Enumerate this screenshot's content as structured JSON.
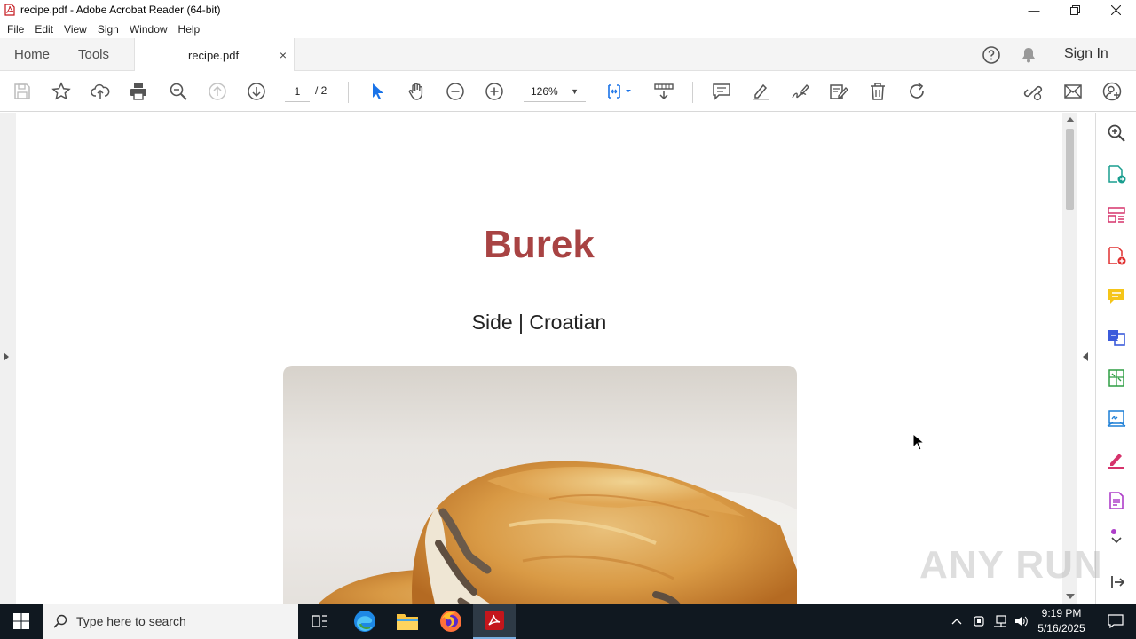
{
  "window": {
    "title": "recipe.pdf - Adobe Acrobat Reader (64-bit)"
  },
  "menu": [
    "File",
    "Edit",
    "View",
    "Sign",
    "Window",
    "Help"
  ],
  "tabs": {
    "home": "Home",
    "tools": "Tools",
    "doc": "recipe.pdf",
    "close": "×"
  },
  "header": {
    "sign_in": "Sign In"
  },
  "toolbar": {
    "page_current": "1",
    "page_total": "/ 2",
    "zoom": "126%"
  },
  "document": {
    "title": "Burek",
    "subtitle": "Side | Croatian"
  },
  "watermark": "ANY RUN",
  "taskbar": {
    "search_placeholder": "Type here to search",
    "time": "9:19 PM",
    "date": "5/16/2025"
  },
  "colors": {
    "title_red": "#a84343",
    "taskbar": "#101820",
    "acrobat_red": "#c4161c"
  },
  "icons": [
    "save-icon",
    "bookmark-star-icon",
    "upload-icon",
    "print-icon",
    "zoom-search-icon",
    "prev-page-icon",
    "next-page-icon",
    "select-arrow-icon",
    "hand-icon",
    "zoom-out-icon",
    "zoom-in-icon",
    "fit-page-icon",
    "scroll-mode-icon",
    "comment-icon",
    "highlight-icon",
    "sign-icon",
    "edit-icon",
    "delete-icon",
    "rotate-icon",
    "share-link-icon",
    "email-icon",
    "user-add-icon"
  ]
}
